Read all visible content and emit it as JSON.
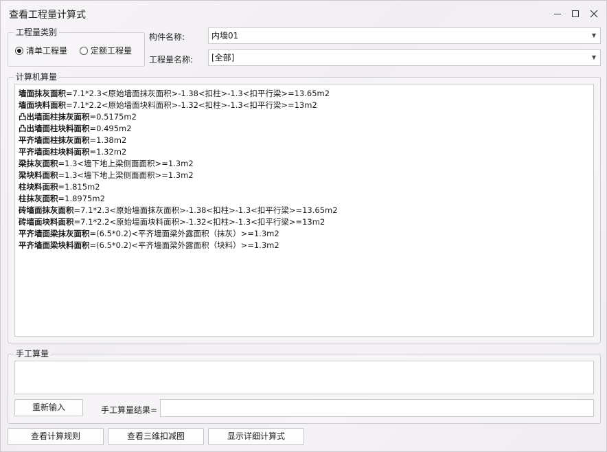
{
  "window": {
    "title": "查看工程量计算式"
  },
  "quantity_type": {
    "legend": "工程量类别",
    "options": [
      {
        "label": "清单工程量",
        "checked": true
      },
      {
        "label": "定额工程量",
        "checked": false
      }
    ]
  },
  "component": {
    "label": "构件名称:",
    "value": "内墙01"
  },
  "quantity_name": {
    "label": "工程量名称:",
    "value": "[全部]"
  },
  "computer_calc": {
    "legend": "计算机算量",
    "lines": [
      {
        "name": "墙面抹灰面积",
        "formula": "=7.1*2.3<原始墙面抹灰面积>-1.38<扣柱>-1.3<扣平行梁>=13.65m2"
      },
      {
        "name": "墙面块料面积",
        "formula": "=7.1*2.2<原始墙面块料面积>-1.32<扣柱>-1.3<扣平行梁>=13m2"
      },
      {
        "name": "凸出墙面柱抹灰面积",
        "formula": "=0.5175m2"
      },
      {
        "name": "凸出墙面柱块料面积",
        "formula": "=0.495m2"
      },
      {
        "name": "平齐墙面柱抹灰面积",
        "formula": "=1.38m2"
      },
      {
        "name": "平齐墙面柱块料面积",
        "formula": "=1.32m2"
      },
      {
        "name": "梁抹灰面积",
        "formula": "=1.3<墙下地上梁侧面面积>=1.3m2"
      },
      {
        "name": "梁块料面积",
        "formula": "=1.3<墙下地上梁侧面面积>=1.3m2"
      },
      {
        "name": "柱块料面积",
        "formula": "=1.815m2"
      },
      {
        "name": "柱抹灰面积",
        "formula": "=1.8975m2"
      },
      {
        "name": "砖墙面抹灰面积",
        "formula": "=7.1*2.3<原始墙面抹灰面积>-1.38<扣柱>-1.3<扣平行梁>=13.65m2"
      },
      {
        "name": "砖墙面块料面积",
        "formula": "=7.1*2.2<原始墙面块料面积>-1.32<扣柱>-1.3<扣平行梁>=13m2"
      },
      {
        "name": "平齐墙面梁抹灰面积",
        "formula": "=(6.5*0.2)<平齐墙面梁外露面积（抹灰）>=1.3m2"
      },
      {
        "name": "平齐墙面梁块料面积",
        "formula": "=(6.5*0.2)<平齐墙面梁外露面积（块料）>=1.3m2"
      }
    ]
  },
  "manual_calc": {
    "legend": "手工算量",
    "reenter_label": "重新输入",
    "result_label": "手工算量结果=",
    "result_value": ""
  },
  "footer": {
    "view_rules_label": "查看计算规则",
    "view_3d_label": "查看三维扣减图",
    "show_detail_label": "显示详细计算式"
  }
}
